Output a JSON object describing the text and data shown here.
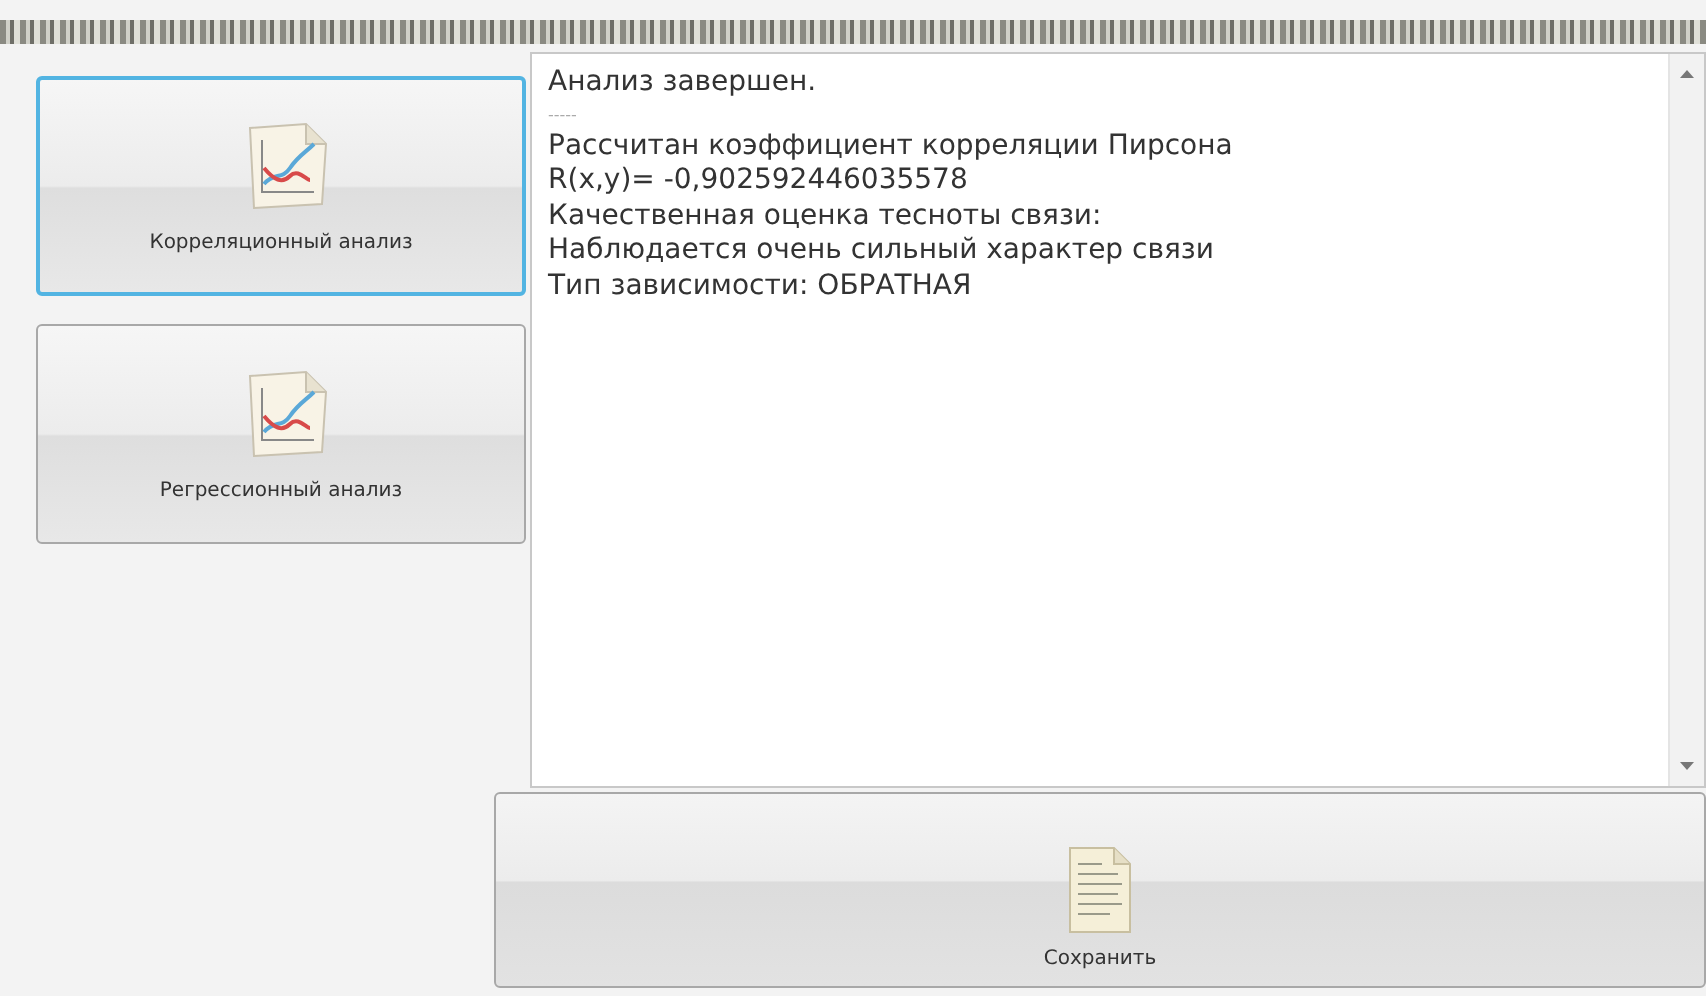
{
  "analysis_buttons": [
    {
      "label": "Корреляционный анализ",
      "selected": true
    },
    {
      "label": "Регрессионный анализ",
      "selected": false
    }
  ],
  "output_lines": [
    "Анализ завершен.",
    "-----",
    "Рассчитан коэффициент корреляции Пирсона",
    "R(x,y)= -0,902592446035578",
    "Качественная оценка тесноты связи:",
    "Наблюдается очень сильный характер связи",
    "Тип зависимости: ОБРАТНАЯ"
  ],
  "save_button": {
    "label": "Сохранить"
  }
}
